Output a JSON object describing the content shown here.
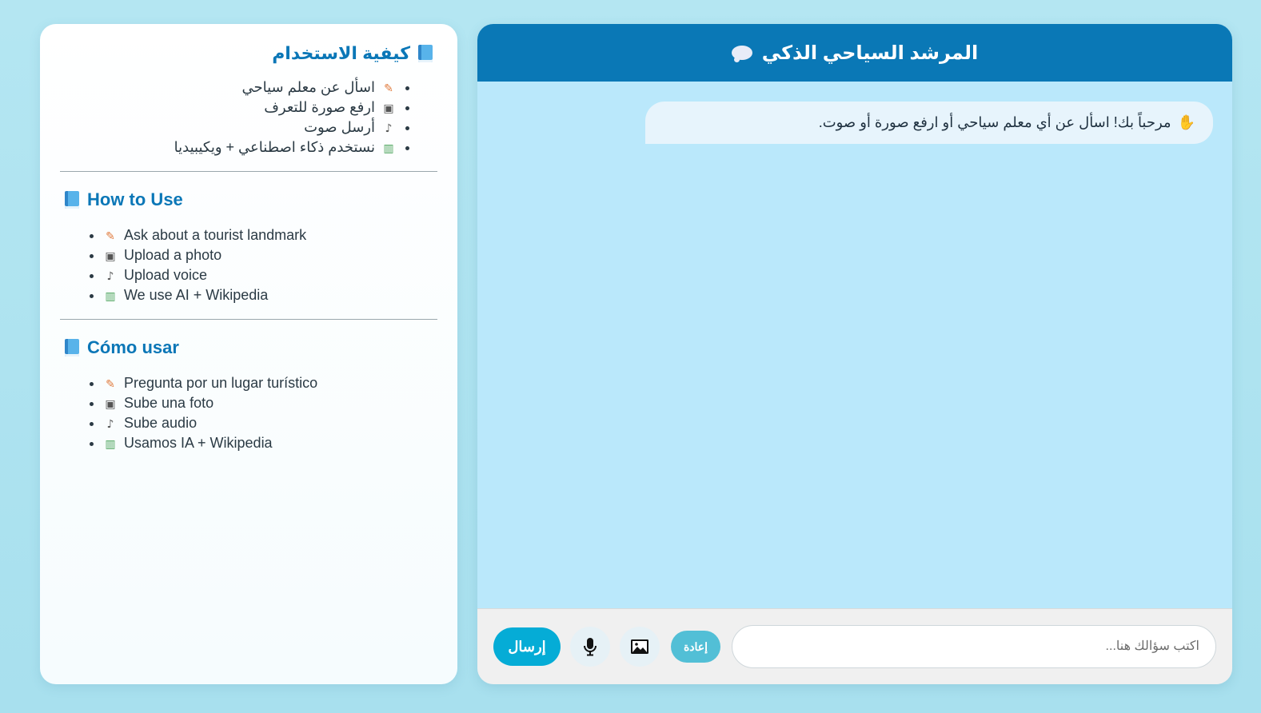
{
  "sidebar": {
    "sections": [
      {
        "title": "كيفية الاستخدام",
        "items": [
          {
            "icon": "memo-icon",
            "text": "اسأل عن معلم سياحي"
          },
          {
            "icon": "camera-icon",
            "text": "ارفع صورة للتعرف"
          },
          {
            "icon": "microphone-icon",
            "text": "أرسل صوت"
          },
          {
            "icon": "books-icon",
            "text": "نستخدم ذكاء اصطناعي + ويكيبيديا"
          }
        ]
      },
      {
        "title": "How to Use",
        "items": [
          {
            "icon": "memo-icon",
            "text": "Ask about a tourist landmark"
          },
          {
            "icon": "camera-icon",
            "text": "Upload a photo"
          },
          {
            "icon": "microphone-icon",
            "text": "Upload voice"
          },
          {
            "icon": "books-icon",
            "text": "We use AI + Wikipedia"
          }
        ]
      },
      {
        "title": "Cómo usar",
        "items": [
          {
            "icon": "memo-icon",
            "text": "Pregunta por un lugar turístico"
          },
          {
            "icon": "camera-icon",
            "text": "Sube una foto"
          },
          {
            "icon": "microphone-icon",
            "text": "Sube audio"
          },
          {
            "icon": "books-icon",
            "text": "Usamos IA + Wikipedia"
          }
        ]
      }
    ]
  },
  "chat": {
    "title": "المرشد السياحي الذكي",
    "title_icon": "speech-bubble-icon",
    "messages": [
      {
        "icon": "waving-hand-icon",
        "text": "مرحباً بك! اسأل عن أي معلم سياحي أو ارفع صورة أو صوت."
      }
    ],
    "composer": {
      "send_label": "إرسال",
      "reset_label": "إعادة",
      "input_placeholder": "اكتب سؤالك هنا...",
      "input_value": ""
    }
  },
  "colors": {
    "page_bg": "#b4e6f2",
    "header_bg": "#0a78b6",
    "chat_bg": "#bae8fb",
    "accent_title": "#0b77b7",
    "send_button": "#05acd6",
    "reset_button": "#52bfd6"
  }
}
